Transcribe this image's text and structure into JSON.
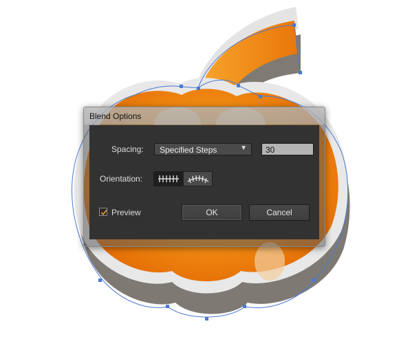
{
  "dialog": {
    "title": "Blend Options",
    "spacing_label": "Spacing:",
    "spacing_value": "Specified Steps",
    "steps_value": "30",
    "orientation_label": "Orientation:",
    "orientation_options": [
      "align-to-page-icon",
      "align-to-path-icon"
    ],
    "preview_label": "Preview",
    "preview_checked": true,
    "ok_label": "OK",
    "cancel_label": "Cancel"
  },
  "colors": {
    "pumpkin_orange": "#F28A0F",
    "pumpkin_shadow": "#7E7A73",
    "selection_blue": "#4A78D6",
    "dialog_panel": "#323232"
  }
}
